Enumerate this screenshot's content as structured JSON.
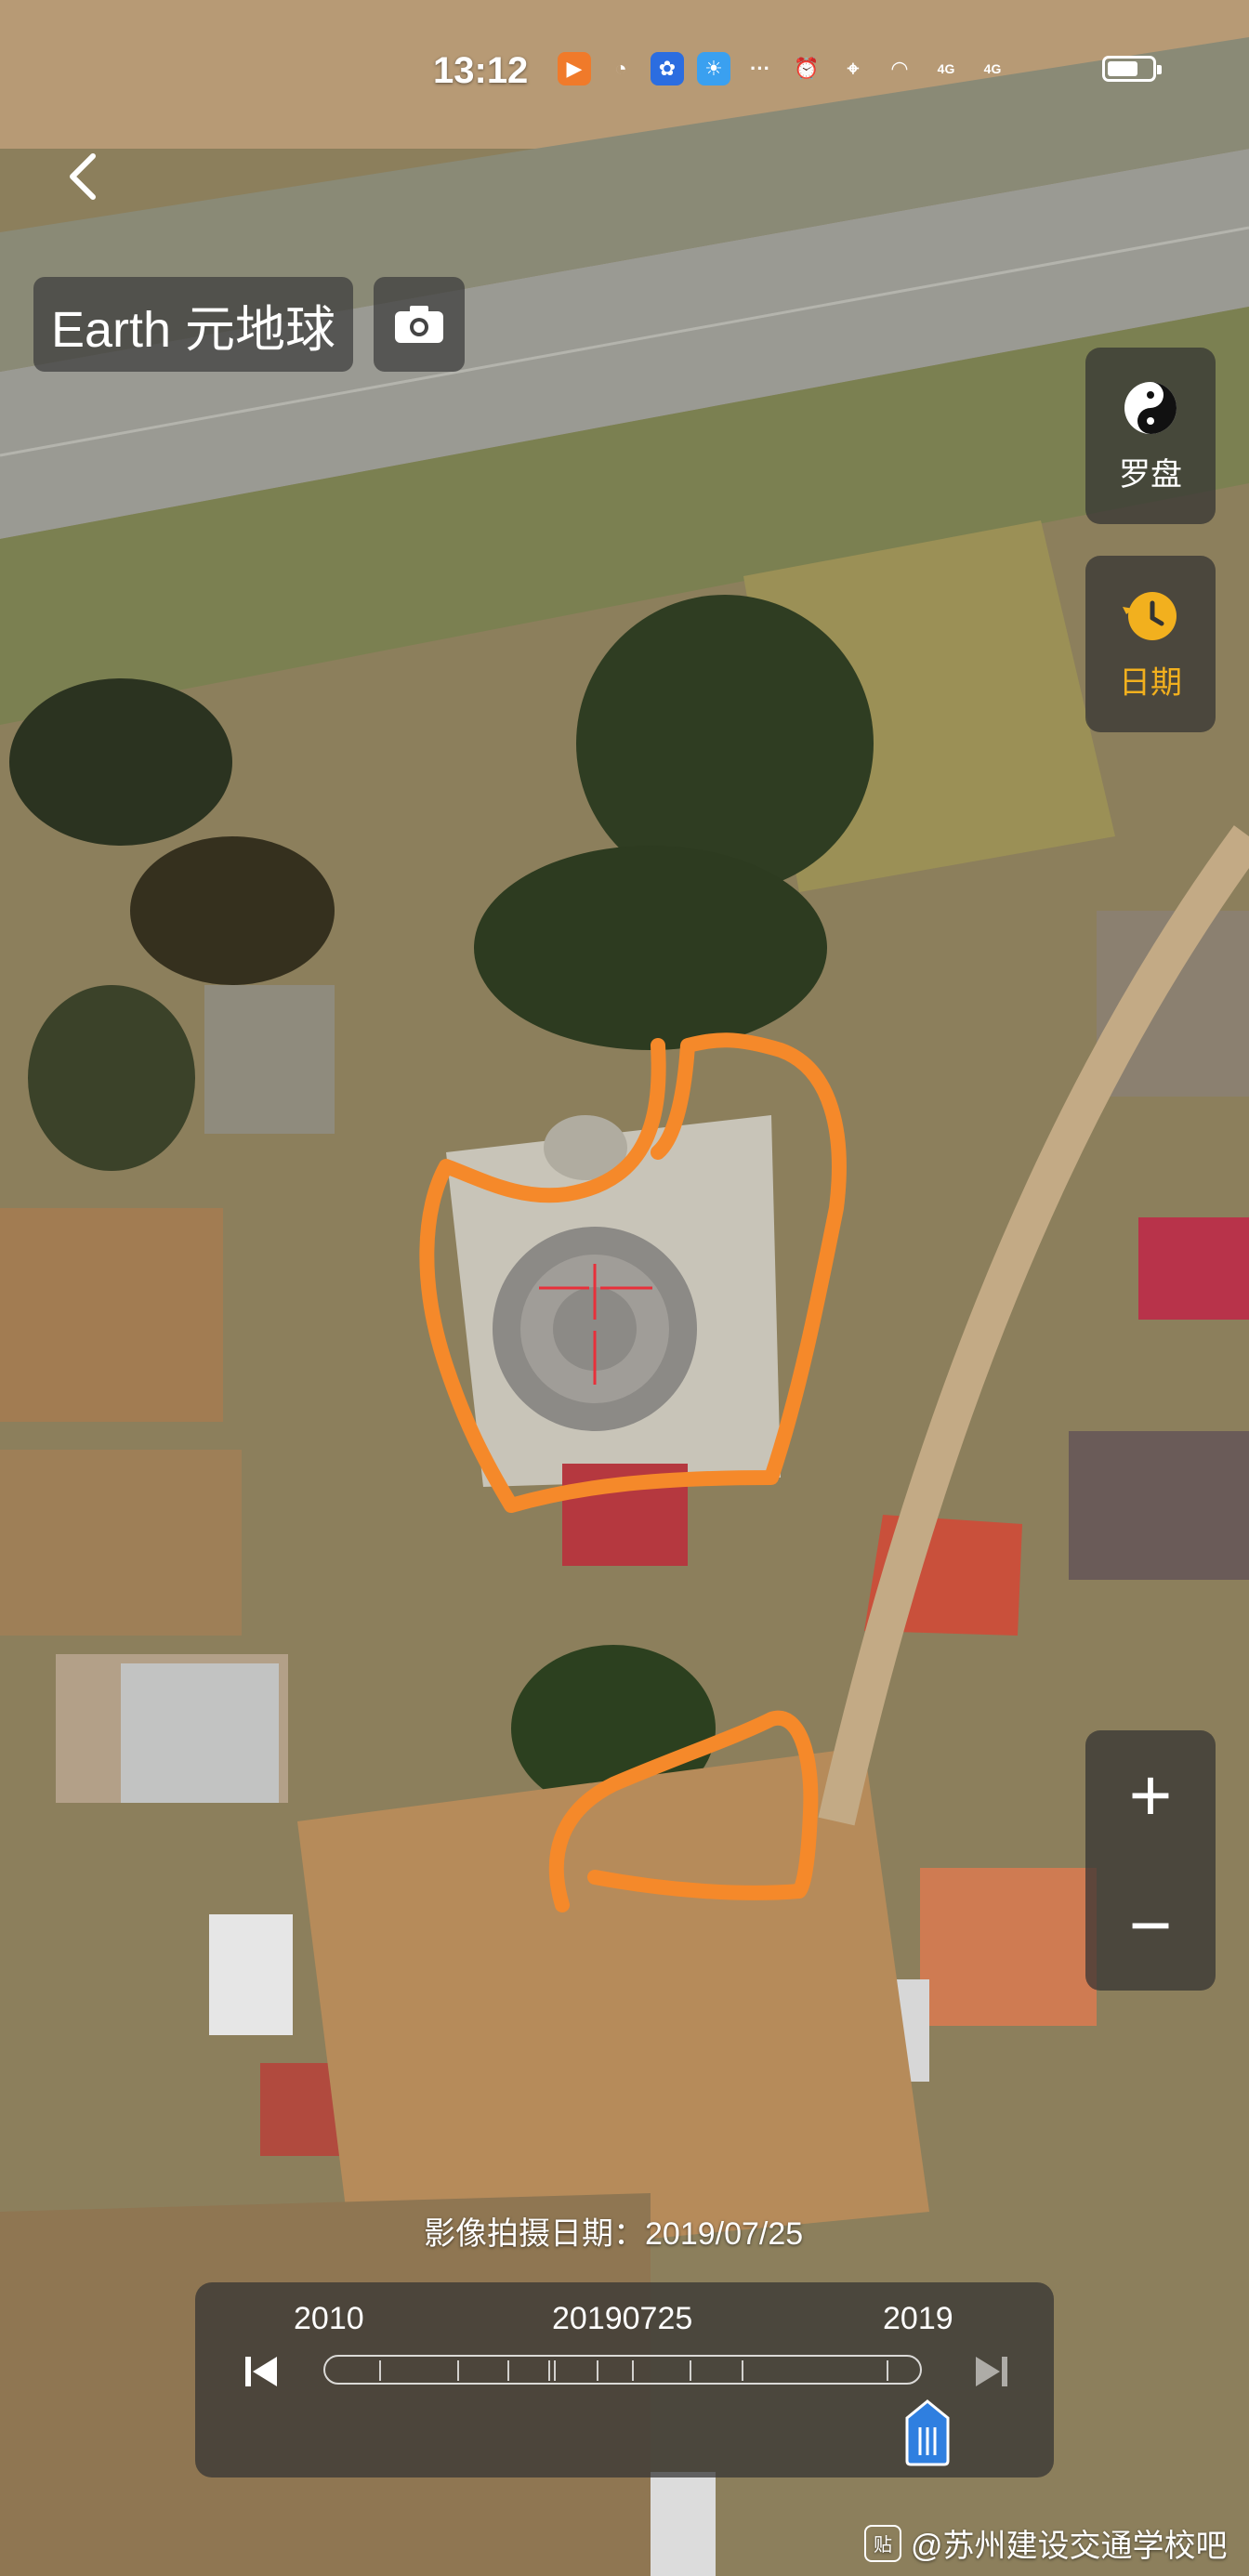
{
  "status_bar": {
    "time": "13:12",
    "network_labels": [
      "4G",
      "4G"
    ]
  },
  "header": {
    "app_title": "Earth 元地球"
  },
  "side_controls": {
    "compass_label": "罗盘",
    "date_label": "日期"
  },
  "zoom": {
    "plus": "+",
    "minus": "−"
  },
  "imagery": {
    "capture_date_caption": "影像拍摄日期：2019/07/25"
  },
  "timeline": {
    "start_year": "2010",
    "current_date": "20190725",
    "end_year": "2019"
  },
  "watermark": {
    "logo_text": "贴",
    "text": "@苏州建设交通学校吧"
  },
  "colors": {
    "annotation_orange": "#f5892a",
    "crosshair_red": "#e8303a",
    "date_accent": "#f2b01e",
    "handle_blue": "#2f7fe0"
  }
}
